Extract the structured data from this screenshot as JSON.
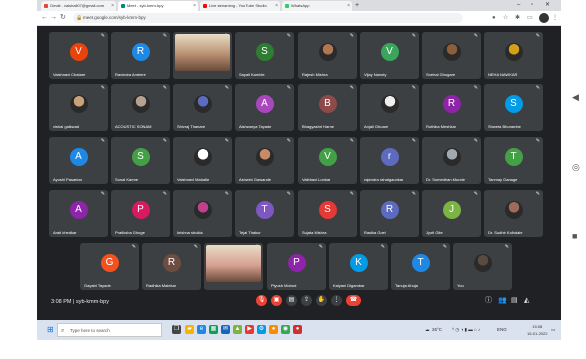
{
  "browser": {
    "tabs": [
      {
        "label": "Gmail - vaishali07@gmail.com",
        "color": "#ea4335"
      },
      {
        "label": "Meet - syb-kmm-bpy",
        "color": "#00897b"
      },
      {
        "label": "Live streaming - YouTube Studio",
        "color": "#ff0000"
      },
      {
        "label": "WhatsApp",
        "color": "#25d366"
      }
    ],
    "new_tab": "+",
    "url": "meet.google.com/syb-kmm-bpy"
  },
  "participants": [
    {
      "name": "Vaishnavi Chatare",
      "initial": "V",
      "color": "#e8430a",
      "kind": "avatar"
    },
    {
      "name": "Ravindra Ambere",
      "initial": "R",
      "color": "#1e88e5",
      "kind": "avatar"
    },
    {
      "name": "",
      "initial": "",
      "color": "#b89070",
      "kind": "video"
    },
    {
      "name": "Sayali Kamble",
      "initial": "S",
      "color": "#2e7d32",
      "kind": "avatar"
    },
    {
      "name": "Rajesh Mishra",
      "initial": "",
      "color": "#b07850",
      "kind": "photo"
    },
    {
      "name": "Vijay Nanoty",
      "initial": "V",
      "color": "#3ba55c",
      "kind": "avatar"
    },
    {
      "name": "Snehal Ghogare",
      "initial": "",
      "color": "#8b5e3c",
      "kind": "photo"
    },
    {
      "name": "NEHA NAWKAR",
      "initial": "",
      "color": "#d4a017",
      "kind": "photo"
    },
    {
      "name": "vishal gaikwad",
      "initial": "",
      "color": "#caa27a",
      "kind": "photo"
    },
    {
      "name": "ACOUSTIC SONAM",
      "initial": "",
      "color": "#b8a090",
      "kind": "photo"
    },
    {
      "name": "Shivraj Thanare",
      "initial": "",
      "color": "#5c6bc0",
      "kind": "photo"
    },
    {
      "name": "Aishwarya Tayade",
      "initial": "A",
      "color": "#ab47bc",
      "kind": "avatar"
    },
    {
      "name": "Bhagyashri Harne",
      "initial": "B",
      "color": "#8d4a4a",
      "kind": "avatar"
    },
    {
      "name": "Anjali Ghuare",
      "initial": "",
      "color": "#eeeeee",
      "kind": "photo"
    },
    {
      "name": "Ruthika Meshkar",
      "initial": "R",
      "color": "#8e24aa",
      "kind": "avatar"
    },
    {
      "name": "Shweta Bhorambe",
      "initial": "S",
      "color": "#039be5",
      "kind": "avatar"
    },
    {
      "name": "Ayushi Pasarkar",
      "initial": "A",
      "color": "#1e88e5",
      "kind": "avatar"
    },
    {
      "name": "Sonal Kamre",
      "initial": "S",
      "color": "#43a047",
      "kind": "avatar"
    },
    {
      "name": "Vaishnavi Mahalle",
      "initial": "",
      "color": "#ffffff",
      "kind": "photo"
    },
    {
      "name": "Ashwini Gawande",
      "initial": "",
      "color": "#c98a6a",
      "kind": "photo"
    },
    {
      "name": "Vaibhavi Lonkar",
      "initial": "V",
      "color": "#43a047",
      "kind": "avatar"
    },
    {
      "name": "rajendra rahatgaonkar",
      "initial": "r",
      "color": "#5c6bc0",
      "kind": "avatar"
    },
    {
      "name": "Dr. Sumedhan Munde",
      "initial": "",
      "color": "#a0a8b0",
      "kind": "photo"
    },
    {
      "name": "Tanmay Ganage",
      "initial": "T",
      "color": "#43a047",
      "kind": "avatar"
    },
    {
      "name": "Arati khedkar",
      "initial": "A",
      "color": "#8e24aa",
      "kind": "avatar"
    },
    {
      "name": "Pratiksha Ghuge",
      "initial": "P",
      "color": "#d81b60",
      "kind": "avatar"
    },
    {
      "name": "krishna shukla",
      "initial": "",
      "color": "#c04090",
      "kind": "photo"
    },
    {
      "name": "Tejal Thakur",
      "initial": "T",
      "color": "#7e57c2",
      "kind": "avatar"
    },
    {
      "name": "Sujata Mishra",
      "initial": "S",
      "color": "#e53935",
      "kind": "avatar"
    },
    {
      "name": "Rasika Goel",
      "initial": "R",
      "color": "#5c6bc0",
      "kind": "avatar"
    },
    {
      "name": "Jyoti Gite",
      "initial": "J",
      "color": "#7cb342",
      "kind": "avatar"
    },
    {
      "name": "Dr. Sudhir Kolhdale",
      "initial": "",
      "color": "#9e6b5a",
      "kind": "photo"
    },
    {
      "name": "Gayatri Tayade",
      "initial": "G",
      "color": "#f4511e",
      "kind": "avatar"
    },
    {
      "name": "Radhika Malekar",
      "initial": "R",
      "color": "#6d4c41",
      "kind": "avatar"
    },
    {
      "name": "",
      "initial": "",
      "color": "#d6a090",
      "kind": "video"
    },
    {
      "name": "Piyush Mohod",
      "initial": "P",
      "color": "#8e24aa",
      "kind": "avatar"
    },
    {
      "name": "Kalyani Digambar",
      "initial": "K",
      "color": "#039be5",
      "kind": "avatar"
    },
    {
      "name": "Tanuja Ahuja",
      "initial": "T",
      "color": "#1e88e5",
      "kind": "avatar"
    },
    {
      "name": "You",
      "initial": "",
      "color": "#5a4a40",
      "kind": "photo"
    }
  ],
  "meeting": {
    "time": "3:08 PM",
    "separator": "|",
    "code": "syb-kmm-bpy"
  },
  "taskbar": {
    "search_placeholder": "Type here to search",
    "temp": "26°C",
    "lang": "ENG",
    "clock_time": "15:08",
    "clock_date": "15-01-2022"
  }
}
